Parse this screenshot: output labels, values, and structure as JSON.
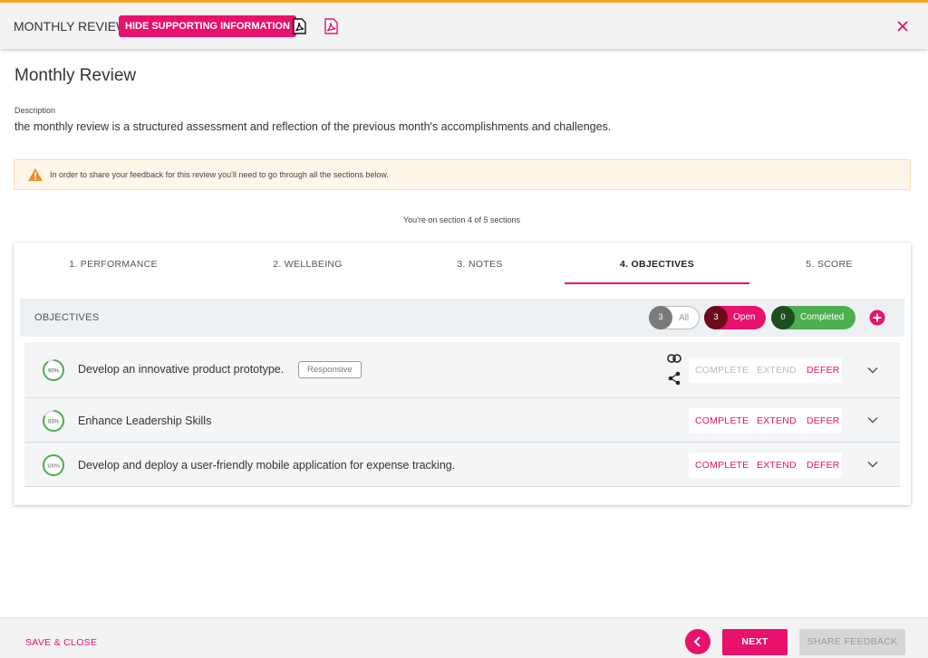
{
  "header": {
    "app_title": "MONTHLY REVIEW",
    "hide_info_label": "HIDE SUPPORTING INFORMATION",
    "icons": [
      "pdf-icon",
      "pdf-icon",
      "close-icon"
    ],
    "accent_color": "#e8116c",
    "top_border_color": "#f5a623"
  },
  "review": {
    "title": "Monthly Review",
    "description_label": "Description",
    "description": "the monthly review is a structured assessment and reflection of the previous month's accomplishments and challenges."
  },
  "warning": {
    "text": "In order to share your feedback for this review you'll need to go through all the sections below.",
    "icon": "warning-icon"
  },
  "progress_text": "You're on section 4 of 5 sections",
  "tabs": [
    {
      "label": "1. PERFORMANCE"
    },
    {
      "label": "2. WELLBEING"
    },
    {
      "label": "3. NOTES"
    },
    {
      "label": "4. OBJECTIVES",
      "active": true
    },
    {
      "label": "5. SCORE"
    }
  ],
  "objectives": {
    "header": "OBJECTIVES",
    "filters": {
      "all": {
        "count": "3",
        "label": "All"
      },
      "open": {
        "count": "3",
        "label": "Open"
      },
      "completed": {
        "count": "0",
        "label": "Completed"
      }
    },
    "items": [
      {
        "name": "Develop an innovative product prototype.",
        "progress": "90%",
        "progress_value": 0.9,
        "tag": "Responsive",
        "complete": "COMPLETE",
        "extend": "EXTEND",
        "defer": "DEFER",
        "actions_disabled": true
      },
      {
        "name": "Enhance Leadership Skills",
        "progress": "83%",
        "progress_value": 0.83,
        "complete": "COMPLETE",
        "extend": "EXTEND",
        "defer": "DEFER"
      },
      {
        "name": "Develop and deploy a user-friendly mobile application for expense tracking.",
        "progress": "100%",
        "progress_value": 1.0,
        "complete": "COMPLETE",
        "extend": "EXTEND",
        "defer": "DEFER"
      }
    ]
  },
  "footer": {
    "save_close": "SAVE & CLOSE",
    "next": "NEXT",
    "share_feedback": "SHARE FEEDBACK"
  }
}
